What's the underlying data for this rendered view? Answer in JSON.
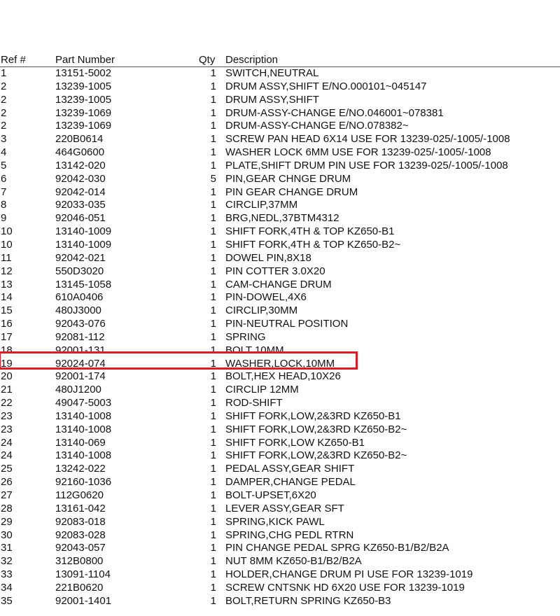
{
  "table": {
    "headers": {
      "ref": "Ref #",
      "part": "Part Number",
      "qty": "Qty",
      "desc": "Description"
    },
    "rows": [
      {
        "ref": "1",
        "part": "13151-5002",
        "qty": "1",
        "desc": "SWITCH,NEUTRAL"
      },
      {
        "ref": "2",
        "part": "13239-1005",
        "qty": "1",
        "desc": "DRUM ASSY,SHIFT  E/NO.000101~045147"
      },
      {
        "ref": "2",
        "part": "13239-1005",
        "qty": "1",
        "desc": "DRUM ASSY,SHIFT"
      },
      {
        "ref": "2",
        "part": "13239-1069",
        "qty": "1",
        "desc": "DRUM-ASSY-CHANGE  E/NO.046001~078381"
      },
      {
        "ref": "2",
        "part": "13239-1069",
        "qty": "1",
        "desc": "DRUM-ASSY-CHANGE  E/NO.078382~"
      },
      {
        "ref": "3",
        "part": "220B0614",
        "qty": "1",
        "desc": "SCREW PAN HEAD 6X14  USE FOR 13239-025/-1005/-1008"
      },
      {
        "ref": "4",
        "part": "464G0600",
        "qty": "1",
        "desc": "WASHER LOCK 6MM  USE FOR 13239-025/-1005/-1008"
      },
      {
        "ref": "5",
        "part": "13142-020",
        "qty": "1",
        "desc": "PLATE,SHIFT DRUM PIN  USE FOR 13239-025/-1005/-1008"
      },
      {
        "ref": "6",
        "part": "92042-030",
        "qty": "5",
        "desc": "PIN,GEAR CHNGE DRUM"
      },
      {
        "ref": "7",
        "part": "92042-014",
        "qty": "1",
        "desc": "PIN GEAR CHANGE DRUM"
      },
      {
        "ref": "8",
        "part": "92033-035",
        "qty": "1",
        "desc": "CIRCLIP,37MM"
      },
      {
        "ref": "9",
        "part": "92046-051",
        "qty": "1",
        "desc": "BRG,NEDL,37BTM4312"
      },
      {
        "ref": "10",
        "part": "13140-1009",
        "qty": "1",
        "desc": "SHIFT FORK,4TH & TOP  KZ650-B1"
      },
      {
        "ref": "10",
        "part": "13140-1009",
        "qty": "1",
        "desc": "SHIFT FORK,4TH & TOP  KZ650-B2~"
      },
      {
        "ref": "11",
        "part": "92042-021",
        "qty": "1",
        "desc": "DOWEL PIN,8X18"
      },
      {
        "ref": "12",
        "part": "550D3020",
        "qty": "1",
        "desc": "PIN COTTER 3.0X20"
      },
      {
        "ref": "13",
        "part": "13145-1058",
        "qty": "1",
        "desc": "CAM-CHANGE DRUM"
      },
      {
        "ref": "14",
        "part": "610A0406",
        "qty": "1",
        "desc": "PIN-DOWEL,4X6"
      },
      {
        "ref": "15",
        "part": "480J3000",
        "qty": "1",
        "desc": "CIRCLIP,30MM"
      },
      {
        "ref": "16",
        "part": "92043-076",
        "qty": "1",
        "desc": "PIN-NEUTRAL POSITION"
      },
      {
        "ref": "17",
        "part": "92081-112",
        "qty": "1",
        "desc": "SPRING"
      },
      {
        "ref": "18",
        "part": "92001-131",
        "qty": "1",
        "desc": "BOLT 10MM"
      },
      {
        "ref": "19",
        "part": "92024-074",
        "qty": "1",
        "desc": "WASHER,LOCK,10MM"
      },
      {
        "ref": "20",
        "part": "92001-174",
        "qty": "1",
        "desc": "BOLT,HEX HEAD,10X26"
      },
      {
        "ref": "21",
        "part": "480J1200",
        "qty": "1",
        "desc": "CIRCLIP 12MM"
      },
      {
        "ref": "22",
        "part": "49047-5003",
        "qty": "1",
        "desc": "ROD-SHIFT"
      },
      {
        "ref": "23",
        "part": "13140-1008",
        "qty": "1",
        "desc": "SHIFT FORK,LOW,2&3RD  KZ650-B1"
      },
      {
        "ref": "23",
        "part": "13140-1008",
        "qty": "1",
        "desc": "SHIFT FORK,LOW,2&3RD  KZ650-B2~"
      },
      {
        "ref": "24",
        "part": "13140-069",
        "qty": "1",
        "desc": "SHIFT FORK,LOW  KZ650-B1"
      },
      {
        "ref": "24",
        "part": "13140-1008",
        "qty": "1",
        "desc": "SHIFT FORK,LOW,2&3RD  KZ650-B2~"
      },
      {
        "ref": "25",
        "part": "13242-022",
        "qty": "1",
        "desc": "PEDAL ASSY,GEAR SHIFT"
      },
      {
        "ref": "26",
        "part": "92160-1036",
        "qty": "1",
        "desc": "DAMPER,CHANGE PEDAL"
      },
      {
        "ref": "27",
        "part": "112G0620",
        "qty": "1",
        "desc": "BOLT-UPSET,6X20"
      },
      {
        "ref": "28",
        "part": "13161-042",
        "qty": "1",
        "desc": "LEVER ASSY,GEAR SFT"
      },
      {
        "ref": "29",
        "part": "92083-018",
        "qty": "1",
        "desc": "SPRING,KICK PAWL"
      },
      {
        "ref": "30",
        "part": "92083-028",
        "qty": "1",
        "desc": "SPRING,CHG PEDL RTRN"
      },
      {
        "ref": "31",
        "part": "92043-057",
        "qty": "1",
        "desc": "PIN CHANGE PEDAL SPRG  KZ650-B1/B2/B2A"
      },
      {
        "ref": "32",
        "part": "312B0800",
        "qty": "1",
        "desc": "NUT 8MM  KZ650-B1/B2/B2A"
      },
      {
        "ref": "33",
        "part": "13091-1104",
        "qty": "1",
        "desc": "HOLDER,CHANGE DRUM PI  USE FOR 13239-1019"
      },
      {
        "ref": "34",
        "part": "221B0620",
        "qty": "1",
        "desc": "SCREW CNTSNK HD 6X20  USE FOR 13239-1019"
      },
      {
        "ref": "35",
        "part": "92001-1401",
        "qty": "1",
        "desc": "BOLT,RETURN SPRING  KZ650-B3"
      }
    ]
  },
  "highlight": {
    "ref": "19",
    "color": "#e01b24"
  }
}
